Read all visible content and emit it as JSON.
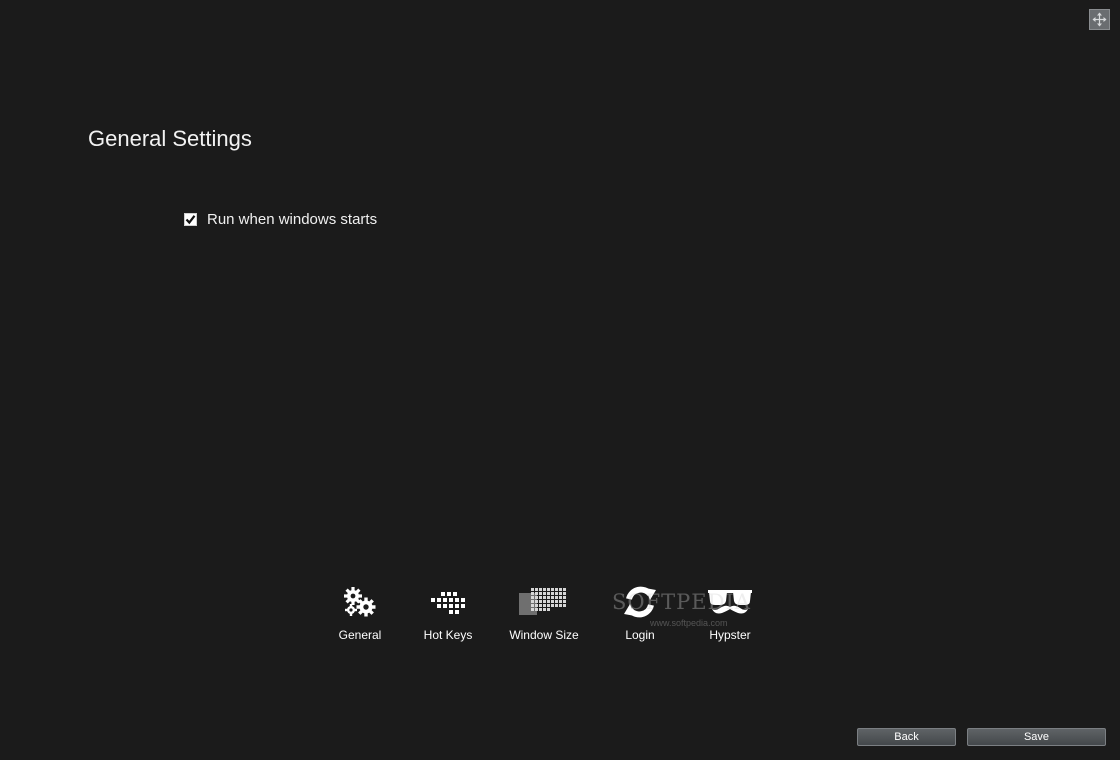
{
  "window": {
    "move_icon": "move-arrows-icon"
  },
  "page": {
    "title": "General Settings"
  },
  "options": {
    "run_on_startup": {
      "label": "Run when windows starts",
      "checked": true
    }
  },
  "nav": {
    "items": [
      {
        "label": "General",
        "icon": "gears-icon"
      },
      {
        "label": "Hot Keys",
        "icon": "keyboard-keys-icon"
      },
      {
        "label": "Window Size",
        "icon": "window-grid-icon"
      },
      {
        "label": "Login",
        "icon": "refresh-arrows-icon"
      },
      {
        "label": "Hypster",
        "icon": "glasses-mustache-icon"
      }
    ]
  },
  "footer": {
    "back_label": "Back",
    "save_label": "Save"
  },
  "watermark": {
    "brand": "SOFTPEDIA",
    "url": "www.softpedia.com"
  },
  "colors": {
    "background": "#1b1b1b",
    "button_top": "#5f6366",
    "button_bottom": "#44484b",
    "text": "#ffffff"
  }
}
